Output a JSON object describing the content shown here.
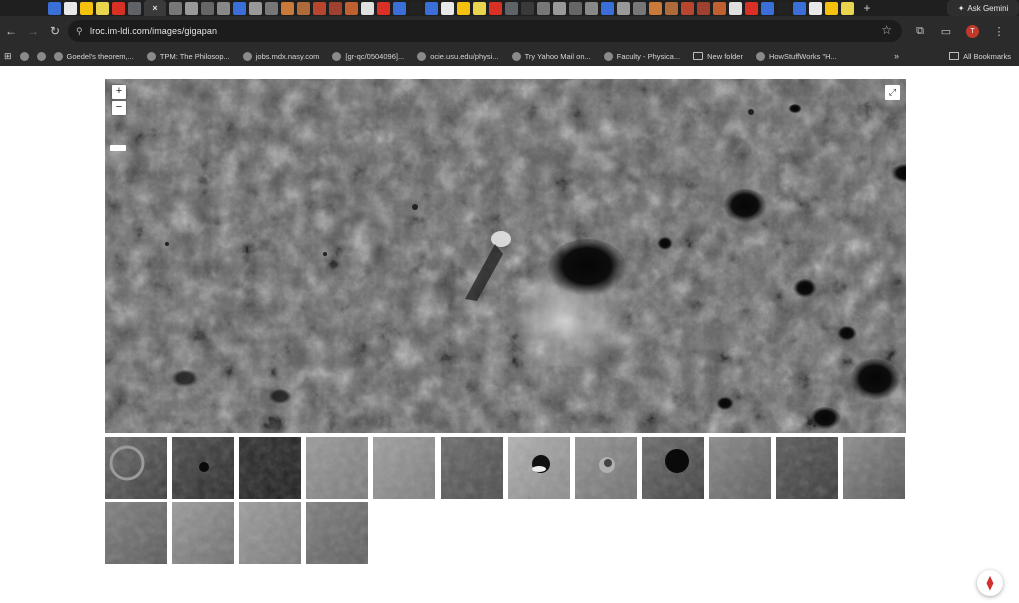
{
  "browser": {
    "tab_icons": [
      "gmail-icon",
      "google-icon",
      "grid-icon",
      "doc-icon",
      "pdf-icon",
      "bookmark-icon",
      "close-icon",
      "site-icon",
      "site-icon",
      "site-icon",
      "site-icon",
      "site-icon",
      "site-icon",
      "site-icon",
      "site-icon",
      "site-icon",
      "site-icon",
      "site-icon",
      "site-icon",
      "youtube-icon",
      "youtube-icon",
      "site-icon",
      "x-icon"
    ],
    "active_tab_close": "×",
    "new_tab": "+",
    "gemini_label": "Ask Gemini",
    "url": "lroc.im-ldi.com/images/gigapan",
    "bookmarks": [
      {
        "label": "Goedel's theorem,..."
      },
      {
        "label": "TPM: The Philosop..."
      },
      {
        "label": "jobs.mdx.nasy.com"
      },
      {
        "label": "[gr-qc/0504096]..."
      },
      {
        "label": "ocie.usu.edu/physi..."
      },
      {
        "label": "Try Yahoo Mail on..."
      },
      {
        "label": "Faculty - Physica..."
      },
      {
        "label": "New folder"
      },
      {
        "label": "HowStuffWorks \"H..."
      }
    ],
    "bookmarks_more": "»",
    "all_bookmarks": "All Bookmarks",
    "profile_initial": "T"
  },
  "viewer": {
    "zoom_in": "+",
    "zoom_out": "−",
    "fullscreen_icon": "⤢"
  },
  "thumbnails": [
    {
      "name": "thumbnail-1"
    },
    {
      "name": "thumbnail-2"
    },
    {
      "name": "thumbnail-3"
    },
    {
      "name": "thumbnail-4"
    },
    {
      "name": "thumbnail-5"
    },
    {
      "name": "thumbnail-6"
    },
    {
      "name": "thumbnail-7"
    },
    {
      "name": "thumbnail-8"
    },
    {
      "name": "thumbnail-9"
    },
    {
      "name": "thumbnail-10"
    },
    {
      "name": "thumbnail-11"
    },
    {
      "name": "thumbnail-12"
    },
    {
      "name": "thumbnail-13"
    },
    {
      "name": "thumbnail-14"
    },
    {
      "name": "thumbnail-15"
    },
    {
      "name": "thumbnail-16"
    }
  ],
  "colors": {
    "chrome_dark": "#1f1f1f",
    "toolbar": "#2b2b2b",
    "pdf_red": "#d32f2f"
  }
}
